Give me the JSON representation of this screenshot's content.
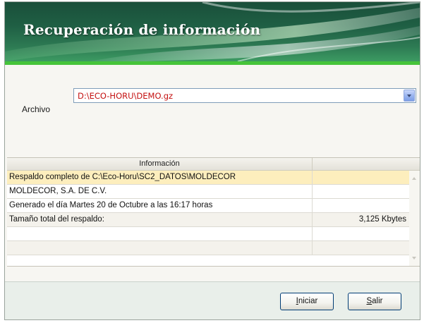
{
  "window": {
    "title": "Recuperación de información"
  },
  "file": {
    "label": "Archivo",
    "value": "D:\\ECO-HORU\\DEMO.gz"
  },
  "grid": {
    "header": "Información",
    "rows": [
      {
        "text": "Respaldo completo de C:\\Eco-Horu\\SC2_DATOS\\MOLDECOR",
        "value": ""
      },
      {
        "text": "MOLDECOR, S.A. DE C.V.",
        "value": ""
      },
      {
        "text": "Generado el día Martes  20 de Octubre a las 16:17 horas",
        "value": ""
      },
      {
        "text": "Tamaño total del respaldo:",
        "value": "3,125 Kbytes"
      },
      {
        "text": "",
        "value": ""
      },
      {
        "text": "",
        "value": ""
      }
    ]
  },
  "buttons": {
    "iniciar": {
      "accel": "I",
      "rest": "niciar"
    },
    "salir": {
      "accel": "S",
      "rest": "alir"
    }
  },
  "colors": {
    "banner": "#1f5f44",
    "accent_line": "#46c43a",
    "file_text": "#c41010",
    "selected_row": "#fdeebd"
  }
}
